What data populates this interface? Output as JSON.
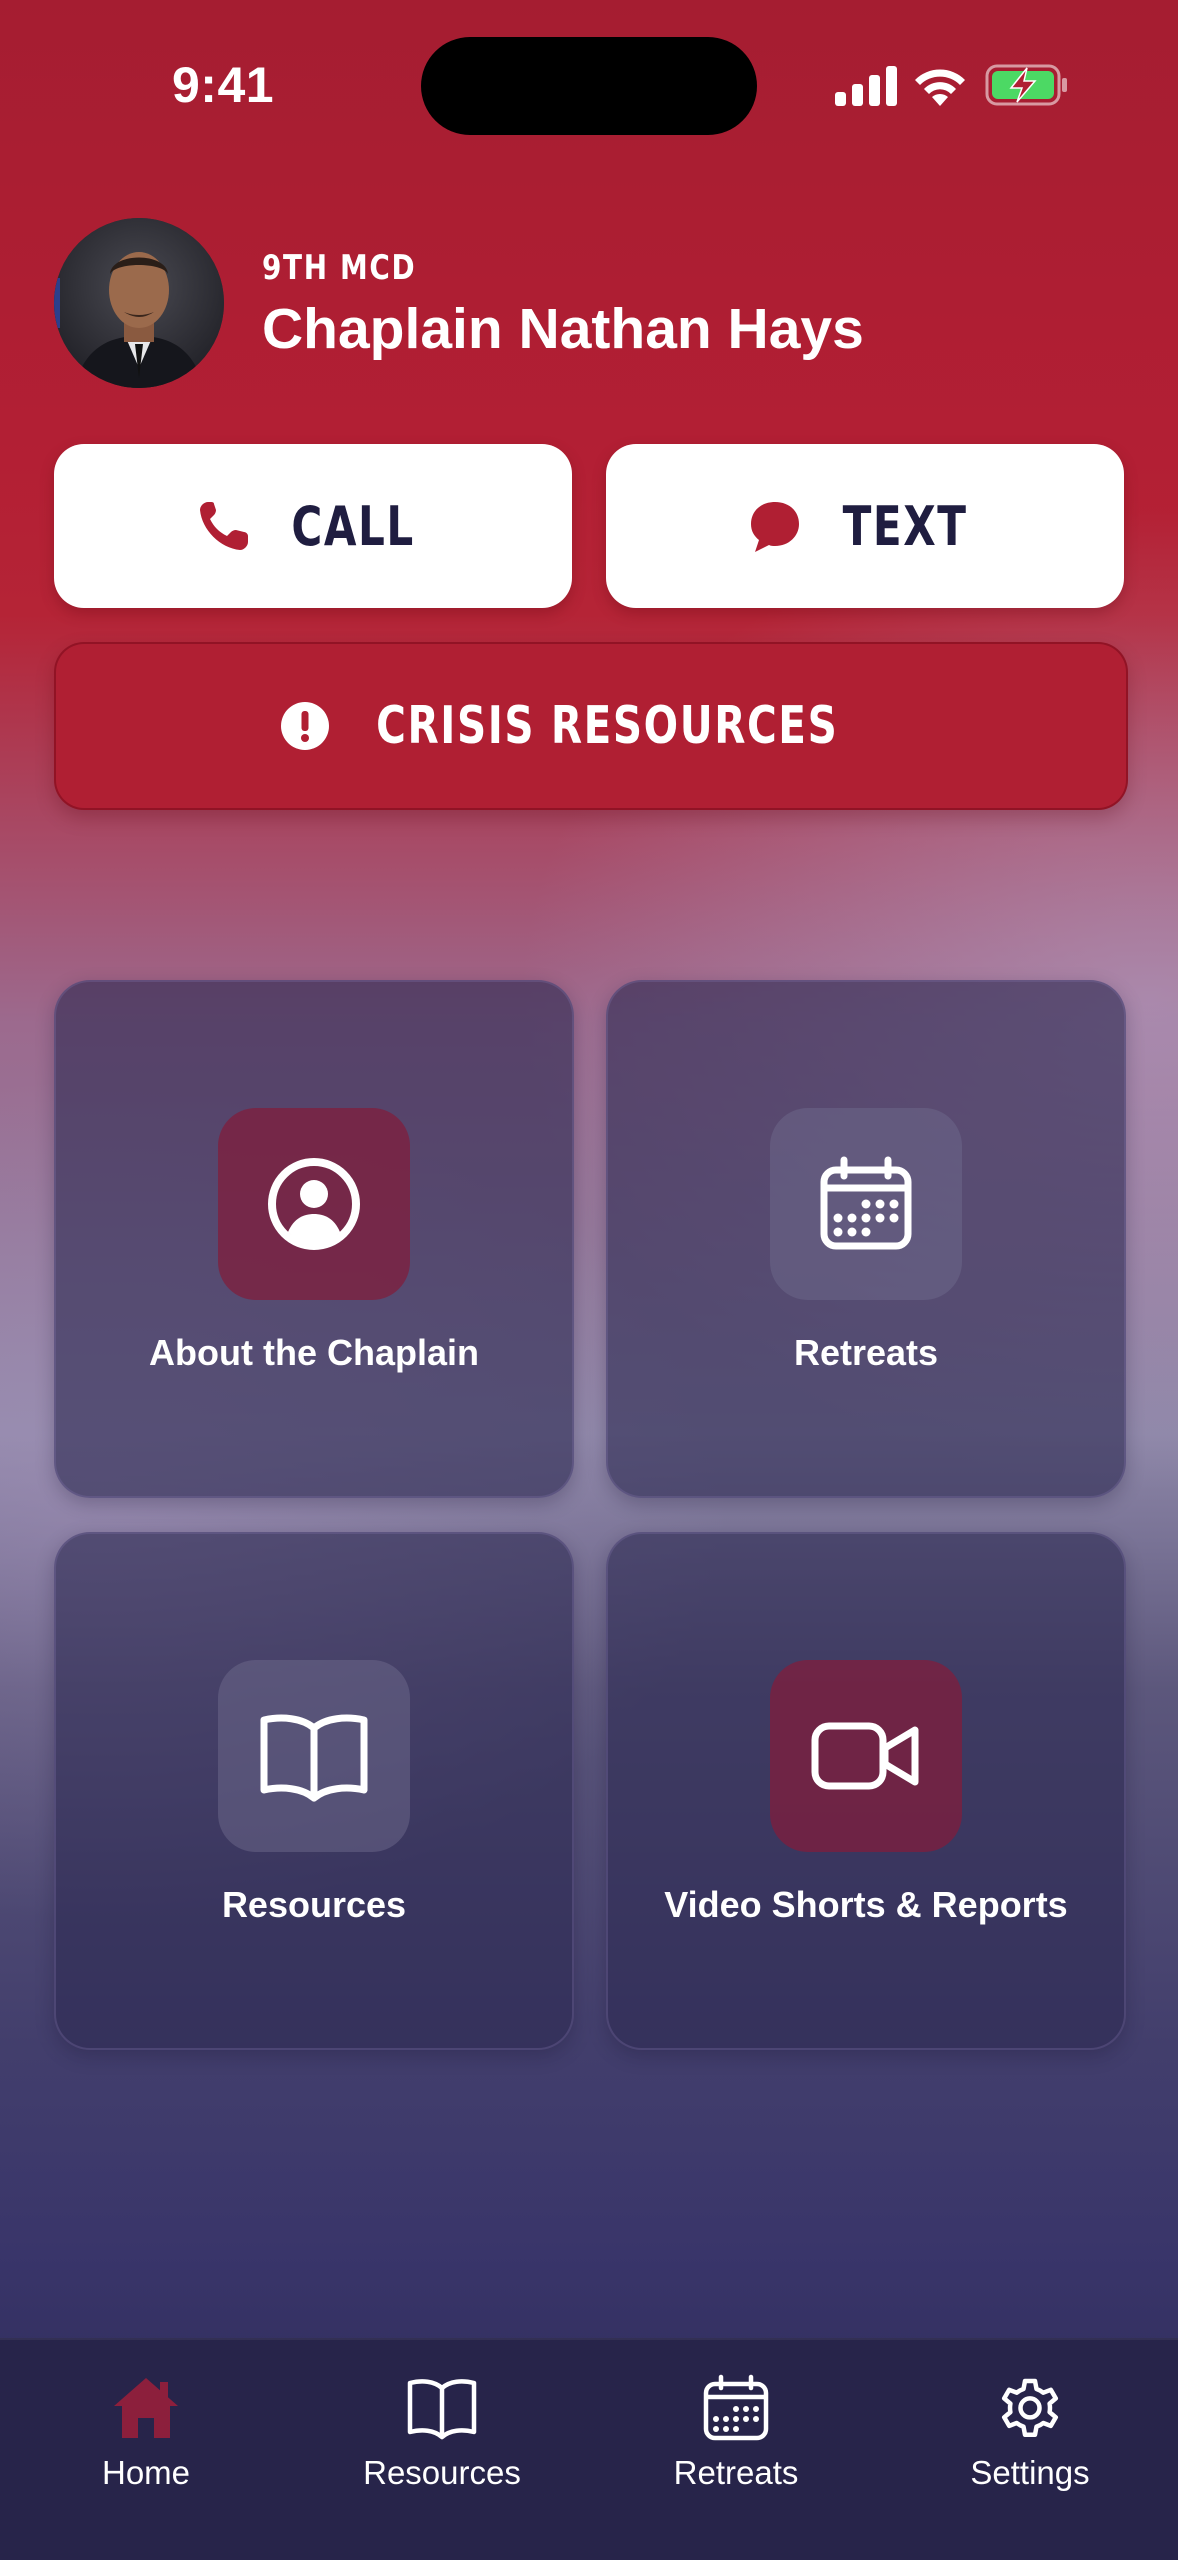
{
  "status_bar": {
    "time": "9:41"
  },
  "profile": {
    "unit": "9TH MCD",
    "name": "Chaplain Nathan Hays"
  },
  "actions": {
    "call_label": "CALL",
    "text_label": "TEXT",
    "crisis_label": "CRISIS RESOURCES"
  },
  "tiles": [
    {
      "label": "About the Chaplain",
      "icon": "person-circle-icon"
    },
    {
      "label": "Retreats",
      "icon": "calendar-icon"
    },
    {
      "label": "Resources",
      "icon": "book-icon"
    },
    {
      "label": "Video Shorts & Reports",
      "icon": "video-camera-icon"
    }
  ],
  "tabbar": {
    "items": [
      {
        "label": "Home",
        "icon": "home-icon",
        "active": true
      },
      {
        "label": "Resources",
        "icon": "book-icon",
        "active": false
      },
      {
        "label": "Retreats",
        "icon": "calendar-icon",
        "active": false
      },
      {
        "label": "Settings",
        "icon": "gear-icon",
        "active": false
      }
    ]
  },
  "colors": {
    "accent_red": "#b01f33",
    "navy_text": "#1f1d40",
    "tab_active": "#8c1f3c",
    "tab_bar_bg": "#27244a",
    "battery_green": "#4cd964"
  }
}
